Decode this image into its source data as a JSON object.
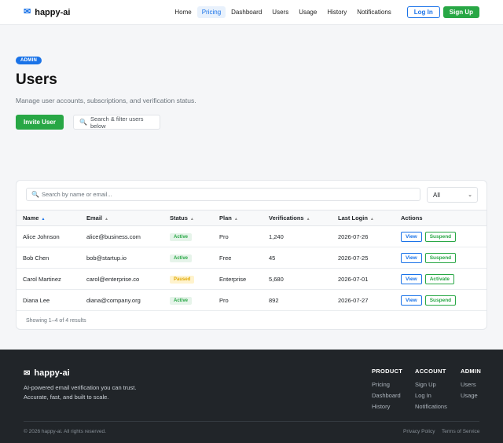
{
  "header": {
    "brand": "happy-ai",
    "nav": [
      "Home",
      "Pricing",
      "Dashboard",
      "Users",
      "Usage",
      "History",
      "Notifications"
    ],
    "login": "Log In",
    "signup": "Sign Up"
  },
  "hero": {
    "badge": "ADMIN",
    "title": "Users",
    "subtitle": "Manage user accounts, subscriptions, and verification status.",
    "invite": "Invite User",
    "hint": "Search & filter users below"
  },
  "table": {
    "search_placeholder": "Search by name or email...",
    "filter_value": "All",
    "columns": [
      "Name",
      "Email",
      "Status",
      "Plan",
      "Verifications",
      "Last Login",
      "Actions"
    ],
    "rows": [
      {
        "name": "Alice Johnson",
        "email": "alice@business.com",
        "status": "Active",
        "plan": "Pro",
        "verifications": "1,240",
        "last_login": "2026-07-26",
        "view": "View",
        "action": "Suspend"
      },
      {
        "name": "Bob Chen",
        "email": "bob@startup.io",
        "status": "Active",
        "plan": "Free",
        "verifications": "45",
        "last_login": "2026-07-25",
        "view": "View",
        "action": "Suspend"
      },
      {
        "name": "Carol Martinez",
        "email": "carol@enterprise.co",
        "status": "Paused",
        "plan": "Enterprise",
        "verifications": "5,680",
        "last_login": "2026-07-01",
        "view": "View",
        "action": "Activate"
      },
      {
        "name": "Diana Lee",
        "email": "diana@company.org",
        "status": "Active",
        "plan": "Pro",
        "verifications": "892",
        "last_login": "2026-07-27",
        "view": "View",
        "action": "Suspend"
      }
    ],
    "results": "Showing 1–4 of 4 results"
  },
  "footer": {
    "brand": "happy-ai",
    "desc": "AI-powered email verification you can trust. Accurate, fast, and built to scale.",
    "cols": [
      {
        "title": "PRODUCT",
        "links": [
          "Pricing",
          "Dashboard",
          "History"
        ]
      },
      {
        "title": "ACCOUNT",
        "links": [
          "Sign Up",
          "Log In",
          "Notifications"
        ]
      },
      {
        "title": "ADMIN",
        "links": [
          "Users",
          "Usage"
        ]
      }
    ],
    "copyright": "© 2026 happy-ai. All rights reserved.",
    "privacy": "Privacy Policy",
    "terms": "Terms of Service"
  },
  "colors": {
    "primary": "#1a73e8",
    "success": "#28a745",
    "warning": "#e0a800",
    "footer_bg": "#212529"
  }
}
